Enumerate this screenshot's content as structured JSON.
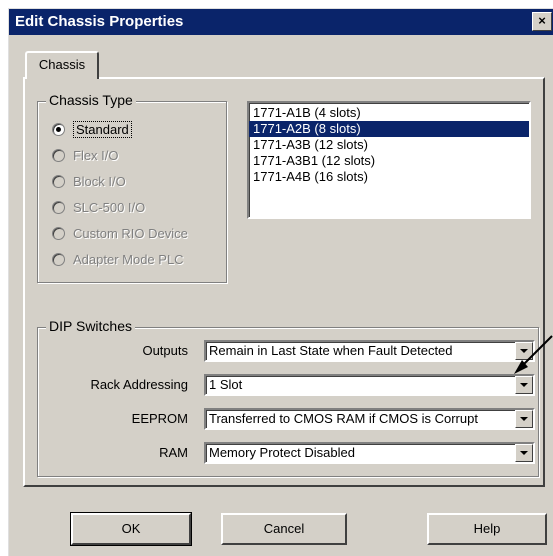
{
  "window": {
    "title": "Edit Chassis Properties",
    "close_label": "×"
  },
  "tabs": [
    {
      "label": "Chassis",
      "active": true
    }
  ],
  "chassis_type": {
    "group_label": "Chassis Type",
    "options": [
      {
        "label": "Standard",
        "selected": true,
        "enabled": true
      },
      {
        "label": "Flex I/O",
        "selected": false,
        "enabled": false
      },
      {
        "label": "Block I/O",
        "selected": false,
        "enabled": false
      },
      {
        "label": "SLC-500 I/O",
        "selected": false,
        "enabled": false
      },
      {
        "label": "Custom RIO Device",
        "selected": false,
        "enabled": false
      },
      {
        "label": "Adapter Mode PLC",
        "selected": false,
        "enabled": false
      }
    ]
  },
  "chassis_list": {
    "items": [
      {
        "label": "1771-A1B (4 slots)",
        "selected": false
      },
      {
        "label": "1771-A2B (8 slots)",
        "selected": true
      },
      {
        "label": "1771-A3B (12 slots)",
        "selected": false
      },
      {
        "label": "1771-A3B1 (12 slots)",
        "selected": false
      },
      {
        "label": "1771-A4B (16 slots)",
        "selected": false
      }
    ]
  },
  "dip_switches": {
    "group_label": "DIP Switches",
    "fields": [
      {
        "label": "Outputs",
        "value": "Remain in Last State when Fault Detected"
      },
      {
        "label": "Rack Addressing",
        "value": "1 Slot"
      },
      {
        "label": "EEPROM",
        "value": "Transferred to CMOS RAM if CMOS is Corrupt"
      },
      {
        "label": "RAM",
        "value": "Memory Protect Disabled"
      }
    ]
  },
  "buttons": {
    "ok": "OK",
    "cancel": "Cancel",
    "help": "Help"
  },
  "colors": {
    "titlebar": "#0a246a",
    "dialog_face": "#d4d0c8",
    "selection": "#0a246a"
  }
}
